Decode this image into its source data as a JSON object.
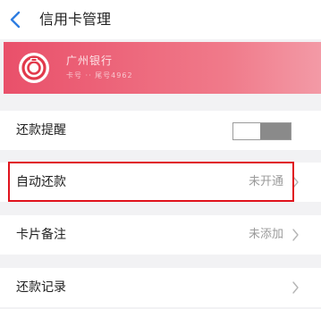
{
  "header": {
    "title": "信用卡管理",
    "back_icon": "chevron-left-icon"
  },
  "card": {
    "bank_name": "广州银行",
    "card_sub": "卡号 ·· 尾号4962",
    "logo_icon": "bank-logo-icon",
    "accent_color": "#e9506a"
  },
  "settings": {
    "repay_reminder": {
      "label": "还款提醒",
      "toggle_on": false
    },
    "auto_repay": {
      "label": "自动还款",
      "value": "未开通",
      "highlighted": true
    },
    "card_note": {
      "label": "卡片备注",
      "value": "未添加"
    },
    "repay_records": {
      "label": "还款记录"
    }
  },
  "colors": {
    "highlight": "#e0131d",
    "back_arrow": "#2f7de1"
  }
}
